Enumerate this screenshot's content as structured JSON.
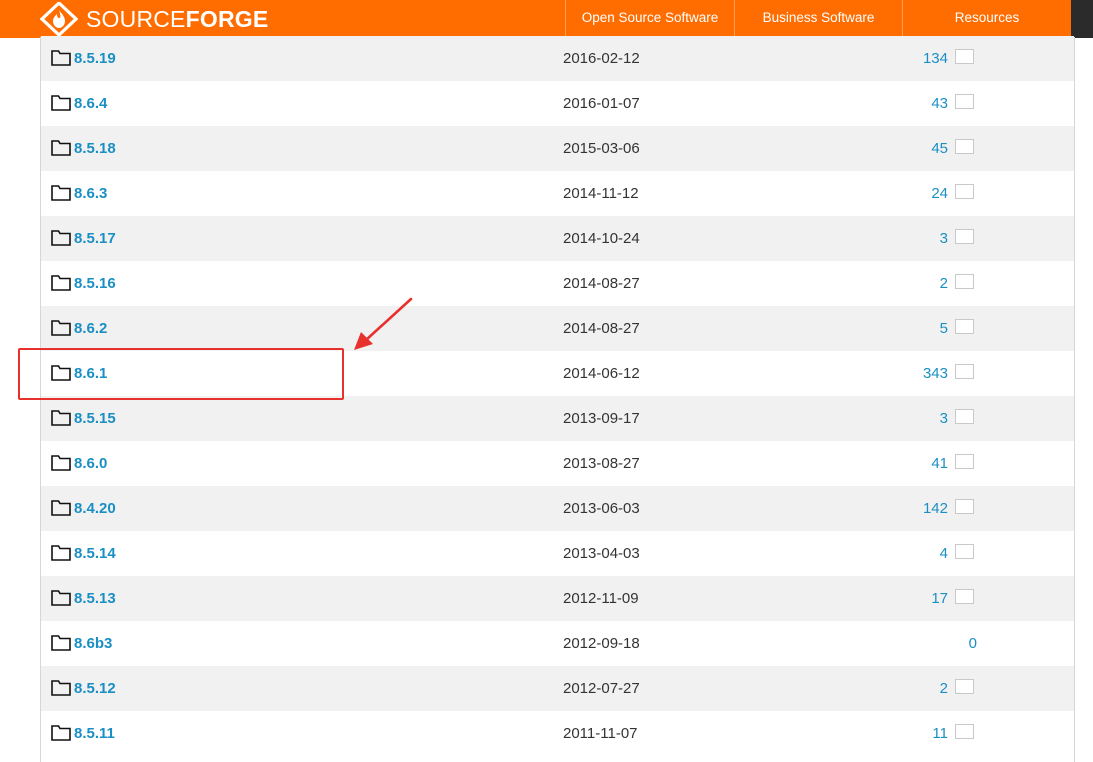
{
  "header": {
    "brand_light": "SOURCE",
    "brand_strong": "FORGE",
    "nav": [
      {
        "label": "Open Source Software"
      },
      {
        "label": "Business Software"
      },
      {
        "label": "Resources"
      }
    ],
    "colors": {
      "bar": "#ff6d00",
      "text": "#ffffff"
    }
  },
  "files": [
    {
      "name": "8.5.19",
      "date": "2016-02-12",
      "downloads": "134",
      "chart": true
    },
    {
      "name": "8.6.4",
      "date": "2016-01-07",
      "downloads": "43",
      "chart": true
    },
    {
      "name": "8.5.18",
      "date": "2015-03-06",
      "downloads": "45",
      "chart": true
    },
    {
      "name": "8.6.3",
      "date": "2014-11-12",
      "downloads": "24",
      "chart": true
    },
    {
      "name": "8.5.17",
      "date": "2014-10-24",
      "downloads": "3",
      "chart": true
    },
    {
      "name": "8.5.16",
      "date": "2014-08-27",
      "downloads": "2",
      "chart": true
    },
    {
      "name": "8.6.2",
      "date": "2014-08-27",
      "downloads": "5",
      "chart": true
    },
    {
      "name": "8.6.1",
      "date": "2014-06-12",
      "downloads": "343",
      "chart": true
    },
    {
      "name": "8.5.15",
      "date": "2013-09-17",
      "downloads": "3",
      "chart": true
    },
    {
      "name": "8.6.0",
      "date": "2013-08-27",
      "downloads": "41",
      "chart": true
    },
    {
      "name": "8.4.20",
      "date": "2013-06-03",
      "downloads": "142",
      "chart": true
    },
    {
      "name": "8.5.14",
      "date": "2013-04-03",
      "downloads": "4",
      "chart": true
    },
    {
      "name": "8.5.13",
      "date": "2012-11-09",
      "downloads": "17",
      "chart": true
    },
    {
      "name": "8.6b3",
      "date": "2012-09-18",
      "downloads": "0",
      "chart": false
    },
    {
      "name": "8.5.12",
      "date": "2012-07-27",
      "downloads": "2",
      "chart": true
    },
    {
      "name": "8.5.11",
      "date": "2011-11-07",
      "downloads": "11",
      "chart": true
    }
  ],
  "annotation": {
    "highlighted_item": "8.6.1",
    "color": "#e8302c"
  },
  "colors": {
    "link": "#1a8fc4",
    "row_alt": "#f1f1f1"
  }
}
